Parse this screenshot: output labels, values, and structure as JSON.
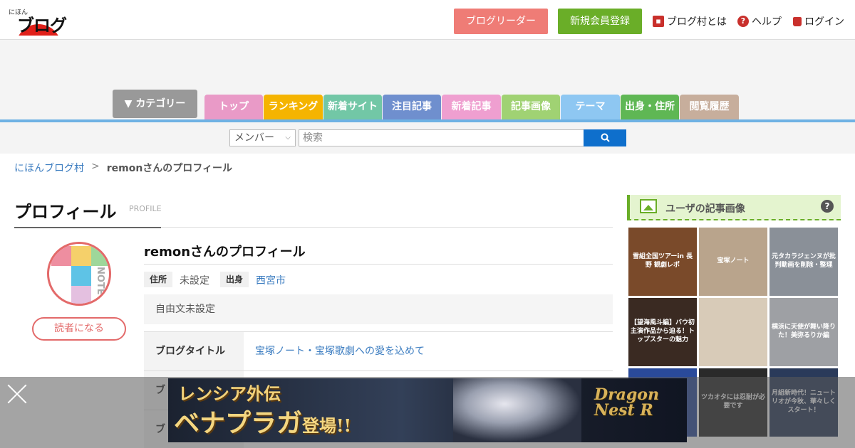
{
  "header": {
    "logo_small": "にほん",
    "logo_text": "ブログ村",
    "reader_label": "ブログリーダー",
    "register_label": "新規会員登録",
    "about_label": "ブログ村とは",
    "help_label": "ヘルプ",
    "login_label": "ログイン"
  },
  "nav": {
    "category_label": "▼ カテゴリー",
    "tabs": [
      {
        "label": "トップ",
        "color": "#e99ac7"
      },
      {
        "label": "ランキング",
        "color": "#f5b400"
      },
      {
        "label": "新着サイト",
        "color": "#72c7a6"
      },
      {
        "label": "注目記事",
        "color": "#6f8fce"
      },
      {
        "label": "新着記事",
        "color": "#ef9fd0"
      },
      {
        "label": "記事画像",
        "color": "#a0d273"
      },
      {
        "label": "テーマ",
        "color": "#8ec7f2"
      },
      {
        "label": "出身・住所",
        "color": "#5fb754"
      },
      {
        "label": "閲覧履歴",
        "color": "#c7ae9c"
      }
    ]
  },
  "search": {
    "select_value": "メンバー",
    "placeholder": "検索"
  },
  "breadcrumb": {
    "home": "にほんブログ村",
    "sep": ">",
    "current": "remonさんのプロフィール"
  },
  "profile": {
    "title": "プロフィール",
    "subtitle": "PROFILE",
    "avatar_text": "NOTE",
    "follow_label": "読者になる",
    "user_heading": "remonさんのプロフィール",
    "address_label": "住所",
    "address_value": "未設定",
    "origin_label": "出身",
    "origin_value": "西宮市",
    "free_text": "自由文未設定",
    "rows": [
      {
        "key": "ブログタイトル",
        "value": "宝塚ノート・宝塚歌劇への愛を込めて"
      },
      {
        "key": "ブ",
        "value": ""
      },
      {
        "key": "ブ",
        "value": ""
      }
    ]
  },
  "sidebar": {
    "title": "ユーザの記事画像",
    "help": "?",
    "thumbs": [
      {
        "caption": "雪組全国ツアーin 長野 観劇レポ",
        "bg": "#7a4a2a"
      },
      {
        "caption": "宝塚ノート",
        "bg": "#b9a48c"
      },
      {
        "caption": "元タカラジェンヌが批判動画を削除・整理",
        "bg": "#8a9098"
      },
      {
        "caption": "【望海風斗編】バウ初主演作品から迫る！トップスターの魅力",
        "bg": "#3a2a22"
      },
      {
        "caption": "",
        "bg": "#d8cbb8"
      },
      {
        "caption": "横浜に天使が舞い降りた！美弥るりか編",
        "bg": "#9ea0a4"
      },
      {
        "caption": "",
        "bg": "#2a4a9a"
      },
      {
        "caption": "ツカオタには忍耐が必要です",
        "bg": "#2a2a2a"
      },
      {
        "caption": "月組新時代！ニュートリオが今秋、華々しくスタート！",
        "bg": "#2a3a5a"
      }
    ]
  },
  "ad": {
    "line1": "レンシア外伝",
    "line2": "ベナプラガ",
    "line2_suffix": "登場!!",
    "brand": "Dragon Nest R"
  }
}
